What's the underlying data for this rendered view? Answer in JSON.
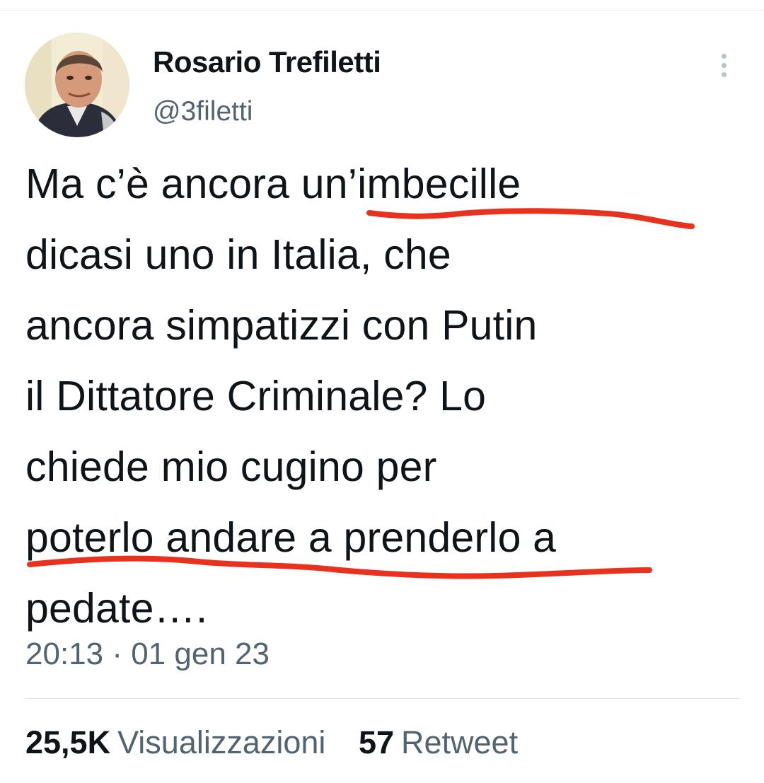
{
  "author": {
    "display_name": "Rosario Trefiletti",
    "handle": "@3filetti",
    "avatar_icon": "profile-photo"
  },
  "menu": {
    "icon": "more-vertical-icon"
  },
  "tweet": {
    "text": "Ma c’è ancora un’imbecille\ndicasi uno in Italia, che\nancora simpatizzi con Putin\nil Dittatore Criminale? Lo\nchiede mio cugino per\npoterlo andare a prenderlo a\npedate….",
    "timestamp": "20:13 · 01 gen 23"
  },
  "annotations": {
    "underline_color": "#e8321e"
  },
  "stats": {
    "views_count": "25,5K",
    "views_label": "Visualizzazioni",
    "retweets_count": "57",
    "retweets_label": "Retweet"
  },
  "colors": {
    "text_primary": "#0f1419",
    "text_secondary": "#536471",
    "divider": "#dfe5e8"
  }
}
